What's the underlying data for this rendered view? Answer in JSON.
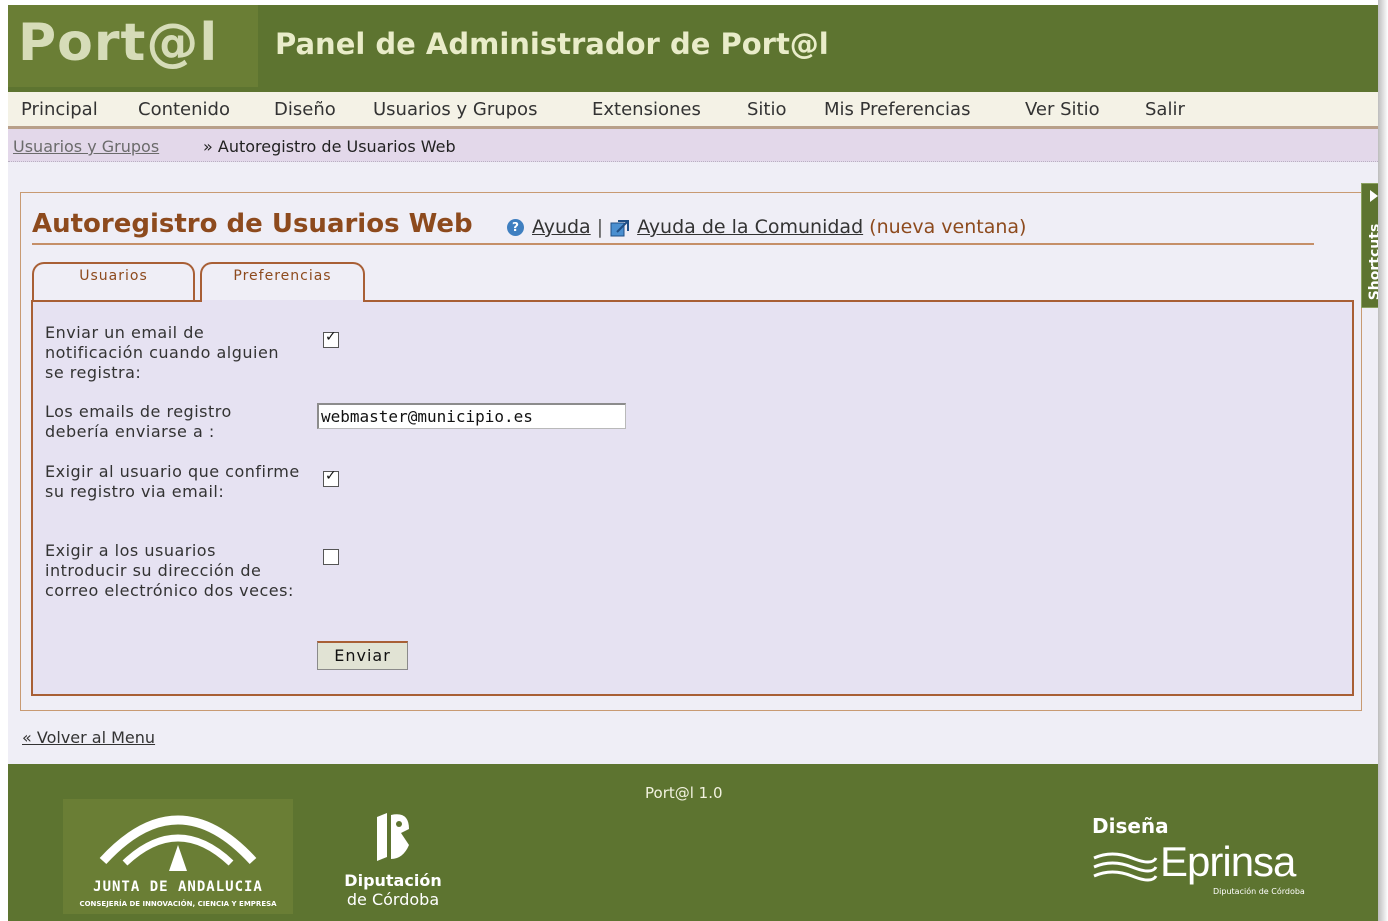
{
  "header": {
    "logo": "Port@l",
    "title": "Panel de Administrador de Port@l"
  },
  "menu": {
    "items": [
      "Principal",
      "Contenido",
      "Diseño",
      "Usuarios y Grupos",
      "Extensiones",
      "Sitio",
      "Mis Preferencias",
      "Ver Sitio",
      "Salir"
    ]
  },
  "breadcrumb": {
    "parent": "Usuarios y Grupos",
    "separator": "»",
    "current": "Autoregistro de Usuarios Web"
  },
  "panel": {
    "title": "Autoregistro de Usuarios Web",
    "help_label": "Ayuda",
    "help_separator": "|",
    "community_label": "Ayuda de la Comunidad",
    "community_note": "(nueva ventana)"
  },
  "tabs": [
    {
      "label": "Usuarios",
      "active": false
    },
    {
      "label": "Preferencias",
      "active": true
    }
  ],
  "form": {
    "notify_label": "Enviar un email de notificación cuando alguien se registra:",
    "notify_checked": true,
    "email_label": "Los emails de registro debería enviarse a :",
    "email_value": "webmaster@municipio.es",
    "confirm_label": "Exigir al usuario que confirme su registro via email:",
    "confirm_checked": true,
    "twice_label": "Exigir a los usuarios introducir su dirección de correo electrónico dos veces:",
    "twice_checked": false,
    "submit_label": "Enviar"
  },
  "back_link": "« Volver al Menu",
  "shortcuts": {
    "label": "Shortcuts"
  },
  "footer": {
    "version": "Port@l 1.0",
    "junta_name": "JUNTA DE ANDALUCIA",
    "junta_sub": "CONSEJERÍA DE INNOVACIÓN, CIENCIA Y EMPRESA",
    "diputacion_1": "Diputación",
    "diputacion_2": "de Córdoba",
    "eprinsa_disena": "Diseña",
    "eprinsa_name": "Eprinsa",
    "eprinsa_sub": "Diputación de Córdoba"
  },
  "colors": {
    "header_green": "#5d7430",
    "title_brown": "#8d4a1d",
    "tab_border": "#a85f35",
    "panel_bg": "#e6e2f2"
  }
}
